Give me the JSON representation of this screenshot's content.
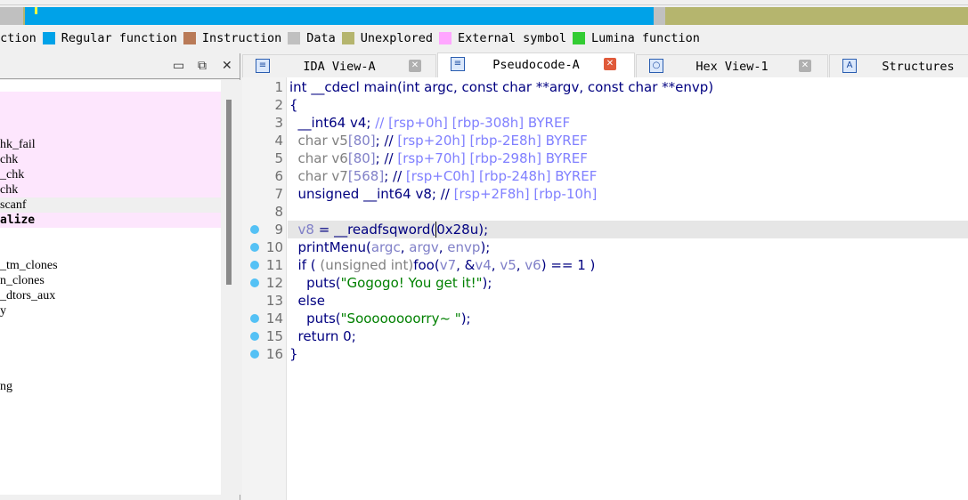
{
  "legend": [
    {
      "label": "nction",
      "color": null
    },
    {
      "label": "Regular function",
      "color": "#00a2e8"
    },
    {
      "label": "Instruction",
      "color": "#b97a57"
    },
    {
      "label": "Data",
      "color": "#c0c0c0"
    },
    {
      "label": "Unexplored",
      "color": "#b5b56e"
    },
    {
      "label": "External symbol",
      "color": "#ffa6ff"
    },
    {
      "label": "Lumina function",
      "color": "#33cc33"
    }
  ],
  "left_panel": {
    "rows": [
      {
        "text": "",
        "style": "pink"
      },
      {
        "text": "",
        "style": "pink"
      },
      {
        "text": "",
        "style": "pink"
      },
      {
        "text": "hk_fail",
        "style": "pink"
      },
      {
        "text": "chk",
        "style": "pink"
      },
      {
        "text": "_chk",
        "style": "pink"
      },
      {
        "text": "chk",
        "style": "pink"
      },
      {
        "text": "scanf",
        "style": "sel"
      },
      {
        "text": "alize",
        "style": "pink bold"
      },
      {
        "text": "",
        "style": ""
      },
      {
        "text": "",
        "style": ""
      },
      {
        "text": "_tm_clones",
        "style": ""
      },
      {
        "text": "n_clones",
        "style": ""
      },
      {
        "text": "_dtors_aux",
        "style": ""
      },
      {
        "text": "y",
        "style": ""
      },
      {
        "text": "",
        "style": ""
      },
      {
        "text": "",
        "style": ""
      },
      {
        "text": "",
        "style": ""
      },
      {
        "text": "",
        "style": ""
      },
      {
        "text": "ng",
        "style": ""
      }
    ]
  },
  "tabs": [
    {
      "label": "IDA View-A",
      "icon": "disassembly-icon",
      "active": false
    },
    {
      "label": "Pseudocode-A",
      "icon": "pseudocode-icon",
      "active": true
    },
    {
      "label": "Hex View-1",
      "icon": "hex-icon",
      "active": false
    },
    {
      "label": "Structures",
      "icon": "structures-icon",
      "active": false
    }
  ],
  "code_lines": [
    {
      "n": "1",
      "dot": false,
      "t": [
        [
          "int __cdecl main(int argc, const char **argv, const char **envp)",
          "k"
        ]
      ]
    },
    {
      "n": "2",
      "dot": false,
      "t": [
        [
          "{",
          "k"
        ]
      ]
    },
    {
      "n": "3",
      "dot": false,
      "t": [
        [
          "  __int64 v4; ",
          "k"
        ],
        [
          "// [rsp+0h] [rbp-308h] BYREF",
          "c"
        ]
      ]
    },
    {
      "n": "4",
      "dot": false,
      "t": [
        [
          "  char v5",
          "g"
        ],
        [
          "[80]",
          "v"
        ],
        [
          "; //",
          "k"
        ],
        [
          " [rsp+20h] [rbp-2E8h] BYREF",
          "c"
        ]
      ]
    },
    {
      "n": "5",
      "dot": false,
      "t": [
        [
          "  char v6",
          "g"
        ],
        [
          "[80]",
          "v"
        ],
        [
          "; //",
          "k"
        ],
        [
          " [rsp+70h] [rbp-298h] BYREF",
          "c"
        ]
      ]
    },
    {
      "n": "6",
      "dot": false,
      "t": [
        [
          "  char v7",
          "g"
        ],
        [
          "[568]",
          "v"
        ],
        [
          "; //",
          "k"
        ],
        [
          " [rsp+C0h] [rbp-248h] BYREF",
          "c"
        ]
      ]
    },
    {
      "n": "7",
      "dot": false,
      "t": [
        [
          "  unsigned __int64 v8; //",
          "k"
        ],
        [
          " [rsp+2F8h] [rbp-10h]",
          "c"
        ]
      ]
    },
    {
      "n": "8",
      "dot": false,
      "t": []
    },
    {
      "n": "9",
      "dot": true,
      "hl": true,
      "t": [
        [
          "  ",
          "k"
        ],
        [
          "v8",
          "v"
        ],
        [
          " = __readfsqword(",
          "k"
        ],
        [
          "0x28u);",
          "k"
        ]
      ]
    },
    {
      "n": "10",
      "dot": true,
      "t": [
        [
          "  printMenu(",
          "k"
        ],
        [
          "argc",
          "v"
        ],
        [
          ", ",
          "k"
        ],
        [
          "argv",
          "v"
        ],
        [
          ", ",
          "k"
        ],
        [
          "envp",
          "v"
        ],
        [
          ");",
          "k"
        ]
      ]
    },
    {
      "n": "11",
      "dot": true,
      "t": [
        [
          "  if ( ",
          "k"
        ],
        [
          "(unsigned int)",
          "g"
        ],
        [
          "foo(",
          "k"
        ],
        [
          "v7",
          "v"
        ],
        [
          ", &",
          "k"
        ],
        [
          "v4",
          "v"
        ],
        [
          ", ",
          "k"
        ],
        [
          "v5",
          "v"
        ],
        [
          ", ",
          "k"
        ],
        [
          "v6",
          "v"
        ],
        [
          ") == 1 )",
          "k"
        ]
      ]
    },
    {
      "n": "12",
      "dot": true,
      "t": [
        [
          "    puts(",
          "k"
        ],
        [
          "\"Gogogo! You get it!\"",
          "s"
        ],
        [
          ");",
          "k"
        ]
      ]
    },
    {
      "n": "13",
      "dot": false,
      "t": [
        [
          "  else",
          "k"
        ]
      ]
    },
    {
      "n": "14",
      "dot": true,
      "t": [
        [
          "    puts(",
          "k"
        ],
        [
          "\"Soooooooorry~ \"",
          "s"
        ],
        [
          ");",
          "k"
        ]
      ]
    },
    {
      "n": "15",
      "dot": true,
      "t": [
        [
          "  return 0;",
          "k"
        ]
      ]
    },
    {
      "n": "16",
      "dot": true,
      "t": [
        [
          "}",
          "k"
        ]
      ]
    }
  ]
}
